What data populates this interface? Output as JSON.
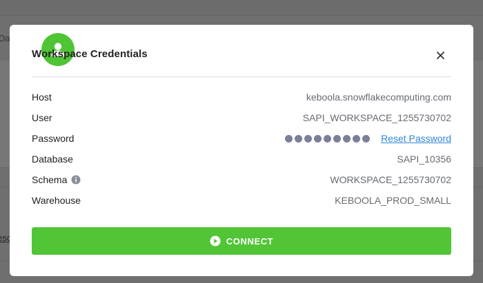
{
  "background": {
    "fragment_text": "Da",
    "fragment_link": "esc"
  },
  "modal": {
    "title": "Workspace Credentials",
    "avatar_icon": "user-icon",
    "close_icon": "close-icon",
    "rows": [
      {
        "label": "Host",
        "value": "keboola.snowflakecomputing.com"
      },
      {
        "label": "User",
        "value": "SAPI_WORKSPACE_1255730702"
      },
      {
        "label": "Password",
        "masked_dot_count": 9,
        "link": "Reset Password"
      },
      {
        "label": "Database",
        "value": "SAPI_10356"
      },
      {
        "label": "Schema",
        "value": "WORKSPACE_1255730702",
        "info_icon": "info-icon"
      },
      {
        "label": "Warehouse",
        "value": "KEBOOLA_PROD_SMALL"
      }
    ],
    "connect": {
      "label": "CONNECT",
      "icon": "play-circle-icon"
    }
  },
  "colors": {
    "accent": "#51c536",
    "link": "#2f86d6",
    "masked_dot": "#7b7f99"
  }
}
